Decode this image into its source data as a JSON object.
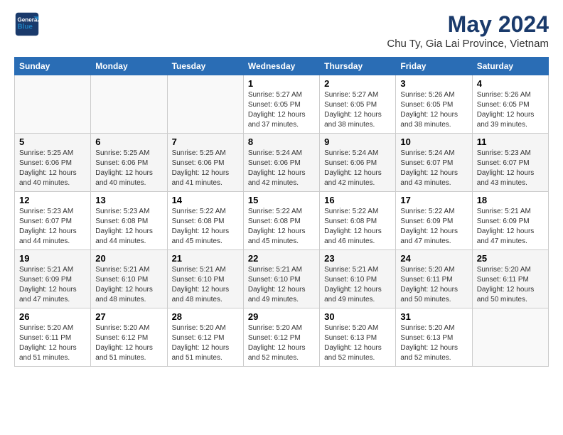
{
  "header": {
    "logo_line1": "General",
    "logo_line2": "Blue",
    "title": "May 2024",
    "subtitle": "Chu Ty, Gia Lai Province, Vietnam"
  },
  "calendar": {
    "days_of_week": [
      "Sunday",
      "Monday",
      "Tuesday",
      "Wednesday",
      "Thursday",
      "Friday",
      "Saturday"
    ],
    "weeks": [
      [
        {
          "day": "",
          "info": ""
        },
        {
          "day": "",
          "info": ""
        },
        {
          "day": "",
          "info": ""
        },
        {
          "day": "1",
          "info": "Sunrise: 5:27 AM\nSunset: 6:05 PM\nDaylight: 12 hours\nand 37 minutes."
        },
        {
          "day": "2",
          "info": "Sunrise: 5:27 AM\nSunset: 6:05 PM\nDaylight: 12 hours\nand 38 minutes."
        },
        {
          "day": "3",
          "info": "Sunrise: 5:26 AM\nSunset: 6:05 PM\nDaylight: 12 hours\nand 38 minutes."
        },
        {
          "day": "4",
          "info": "Sunrise: 5:26 AM\nSunset: 6:05 PM\nDaylight: 12 hours\nand 39 minutes."
        }
      ],
      [
        {
          "day": "5",
          "info": "Sunrise: 5:25 AM\nSunset: 6:06 PM\nDaylight: 12 hours\nand 40 minutes."
        },
        {
          "day": "6",
          "info": "Sunrise: 5:25 AM\nSunset: 6:06 PM\nDaylight: 12 hours\nand 40 minutes."
        },
        {
          "day": "7",
          "info": "Sunrise: 5:25 AM\nSunset: 6:06 PM\nDaylight: 12 hours\nand 41 minutes."
        },
        {
          "day": "8",
          "info": "Sunrise: 5:24 AM\nSunset: 6:06 PM\nDaylight: 12 hours\nand 42 minutes."
        },
        {
          "day": "9",
          "info": "Sunrise: 5:24 AM\nSunset: 6:06 PM\nDaylight: 12 hours\nand 42 minutes."
        },
        {
          "day": "10",
          "info": "Sunrise: 5:24 AM\nSunset: 6:07 PM\nDaylight: 12 hours\nand 43 minutes."
        },
        {
          "day": "11",
          "info": "Sunrise: 5:23 AM\nSunset: 6:07 PM\nDaylight: 12 hours\nand 43 minutes."
        }
      ],
      [
        {
          "day": "12",
          "info": "Sunrise: 5:23 AM\nSunset: 6:07 PM\nDaylight: 12 hours\nand 44 minutes."
        },
        {
          "day": "13",
          "info": "Sunrise: 5:23 AM\nSunset: 6:08 PM\nDaylight: 12 hours\nand 44 minutes."
        },
        {
          "day": "14",
          "info": "Sunrise: 5:22 AM\nSunset: 6:08 PM\nDaylight: 12 hours\nand 45 minutes."
        },
        {
          "day": "15",
          "info": "Sunrise: 5:22 AM\nSunset: 6:08 PM\nDaylight: 12 hours\nand 45 minutes."
        },
        {
          "day": "16",
          "info": "Sunrise: 5:22 AM\nSunset: 6:08 PM\nDaylight: 12 hours\nand 46 minutes."
        },
        {
          "day": "17",
          "info": "Sunrise: 5:22 AM\nSunset: 6:09 PM\nDaylight: 12 hours\nand 47 minutes."
        },
        {
          "day": "18",
          "info": "Sunrise: 5:21 AM\nSunset: 6:09 PM\nDaylight: 12 hours\nand 47 minutes."
        }
      ],
      [
        {
          "day": "19",
          "info": "Sunrise: 5:21 AM\nSunset: 6:09 PM\nDaylight: 12 hours\nand 47 minutes."
        },
        {
          "day": "20",
          "info": "Sunrise: 5:21 AM\nSunset: 6:10 PM\nDaylight: 12 hours\nand 48 minutes."
        },
        {
          "day": "21",
          "info": "Sunrise: 5:21 AM\nSunset: 6:10 PM\nDaylight: 12 hours\nand 48 minutes."
        },
        {
          "day": "22",
          "info": "Sunrise: 5:21 AM\nSunset: 6:10 PM\nDaylight: 12 hours\nand 49 minutes."
        },
        {
          "day": "23",
          "info": "Sunrise: 5:21 AM\nSunset: 6:10 PM\nDaylight: 12 hours\nand 49 minutes."
        },
        {
          "day": "24",
          "info": "Sunrise: 5:20 AM\nSunset: 6:11 PM\nDaylight: 12 hours\nand 50 minutes."
        },
        {
          "day": "25",
          "info": "Sunrise: 5:20 AM\nSunset: 6:11 PM\nDaylight: 12 hours\nand 50 minutes."
        }
      ],
      [
        {
          "day": "26",
          "info": "Sunrise: 5:20 AM\nSunset: 6:11 PM\nDaylight: 12 hours\nand 51 minutes."
        },
        {
          "day": "27",
          "info": "Sunrise: 5:20 AM\nSunset: 6:12 PM\nDaylight: 12 hours\nand 51 minutes."
        },
        {
          "day": "28",
          "info": "Sunrise: 5:20 AM\nSunset: 6:12 PM\nDaylight: 12 hours\nand 51 minutes."
        },
        {
          "day": "29",
          "info": "Sunrise: 5:20 AM\nSunset: 6:12 PM\nDaylight: 12 hours\nand 52 minutes."
        },
        {
          "day": "30",
          "info": "Sunrise: 5:20 AM\nSunset: 6:13 PM\nDaylight: 12 hours\nand 52 minutes."
        },
        {
          "day": "31",
          "info": "Sunrise: 5:20 AM\nSunset: 6:13 PM\nDaylight: 12 hours\nand 52 minutes."
        },
        {
          "day": "",
          "info": ""
        }
      ]
    ]
  }
}
